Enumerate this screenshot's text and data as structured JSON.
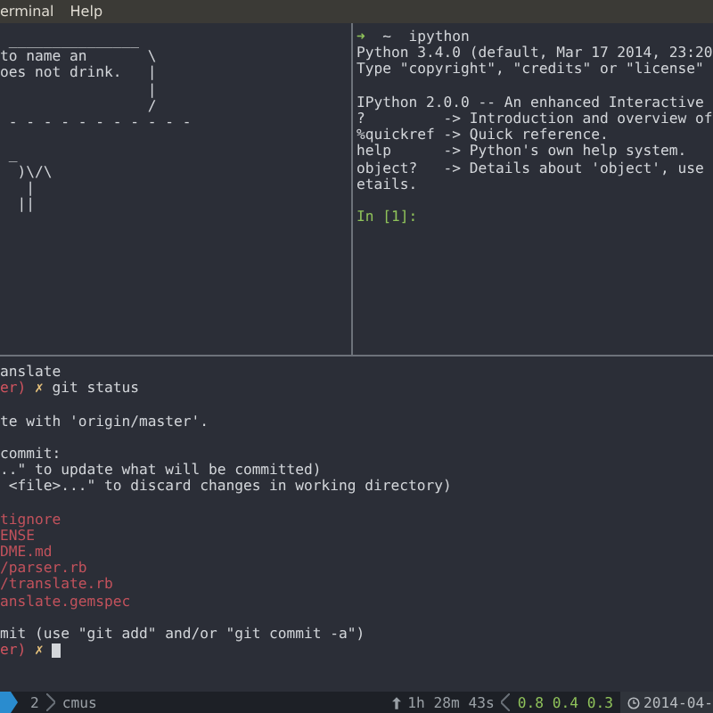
{
  "menu": [
    {
      "label": "erminal"
    },
    {
      "label": "Help"
    }
  ],
  "cowsay_pane": {
    "lines": [
      {
        "text": " _______________"
      },
      {
        "text": "to name an       \\"
      },
      {
        "text": "oes not drink.   |"
      },
      {
        "text": "                 |"
      },
      {
        "text": "                 /"
      },
      {
        "text": " - - - - - - - - - - -"
      },
      {
        "text": " _",
        "blank_before": true
      },
      {
        "text": "  )\\/\\"
      },
      {
        "text": "   |"
      },
      {
        "text": "  ||"
      }
    ]
  },
  "ipython_pane": {
    "lines": [
      {
        "spans": [
          {
            "kind": "arrow",
            "text": "➜"
          },
          {
            "kind": "text",
            "text": "  ~  ipython"
          }
        ]
      },
      {
        "spans": [
          {
            "kind": "text",
            "text": "Python 3.4.0 (default, Mar 17 2014, 23:20"
          }
        ]
      },
      {
        "spans": [
          {
            "kind": "text",
            "text": "Type \"copyright\", \"credits\" or \"license\""
          }
        ]
      },
      {
        "spans": [
          {
            "kind": "text",
            "text": "IPython 2.0.0 -- An enhanced Interactive"
          }
        ],
        "blank_before": true
      },
      {
        "spans": [
          {
            "kind": "text",
            "text": "?         -> Introduction and overview of"
          }
        ]
      },
      {
        "spans": [
          {
            "kind": "text",
            "text": "%quickref -> Quick reference."
          }
        ]
      },
      {
        "spans": [
          {
            "kind": "text",
            "text": "help      -> Python's own help system."
          }
        ]
      },
      {
        "spans": [
          {
            "kind": "text",
            "text": "object?   -> Details about 'object', use"
          }
        ]
      },
      {
        "spans": [
          {
            "kind": "text",
            "text": "etails."
          }
        ]
      },
      {
        "spans": [
          {
            "kind": "input",
            "text": "In [1]:"
          }
        ],
        "blank_before": true
      }
    ]
  },
  "shell_pane": {
    "lines": [
      {
        "spans": [
          {
            "kind": "text",
            "text": "anslate"
          }
        ]
      },
      {
        "spans": [
          {
            "kind": "branch",
            "text": "er)"
          },
          {
            "kind": "mark",
            "text": " ✗ "
          },
          {
            "kind": "text",
            "text": "git status"
          }
        ]
      },
      {
        "spans": [
          {
            "kind": "text",
            "text": "te with 'origin/master'."
          }
        ],
        "blank_before": true
      },
      {
        "spans": [
          {
            "kind": "text",
            "text": "commit:"
          }
        ],
        "blank_before": true
      },
      {
        "spans": [
          {
            "kind": "text",
            "text": "..\" to update what will be committed)"
          }
        ]
      },
      {
        "spans": [
          {
            "kind": "text",
            "text": " <file>...\" to discard changes in working directory)"
          }
        ]
      },
      {
        "spans": [
          {
            "kind": "file",
            "text": "tignore"
          }
        ],
        "blank_before": true
      },
      {
        "spans": [
          {
            "kind": "file",
            "text": "ENSE"
          }
        ]
      },
      {
        "spans": [
          {
            "kind": "file",
            "text": "DME.md"
          }
        ]
      },
      {
        "spans": [
          {
            "kind": "file",
            "text": "/parser.rb"
          }
        ]
      },
      {
        "spans": [
          {
            "kind": "file",
            "text": "/translate.rb"
          }
        ]
      },
      {
        "spans": [
          {
            "kind": "file",
            "text": "anslate.gemspec"
          }
        ]
      },
      {
        "spans": [
          {
            "kind": "text",
            "text": "mit (use \"git add\" and/or \"git commit -a\")"
          }
        ],
        "blank_before": true
      },
      {
        "spans": [
          {
            "kind": "branch",
            "text": "er)"
          },
          {
            "kind": "mark",
            "text": " ✗ "
          },
          {
            "kind": "cursor"
          }
        ]
      }
    ]
  },
  "status_bar": {
    "session_number": "2",
    "window_name": "cmus",
    "uptime": "1h 28m 43s",
    "load": "0.8 0.4 0.3",
    "date": "2014-04-"
  }
}
